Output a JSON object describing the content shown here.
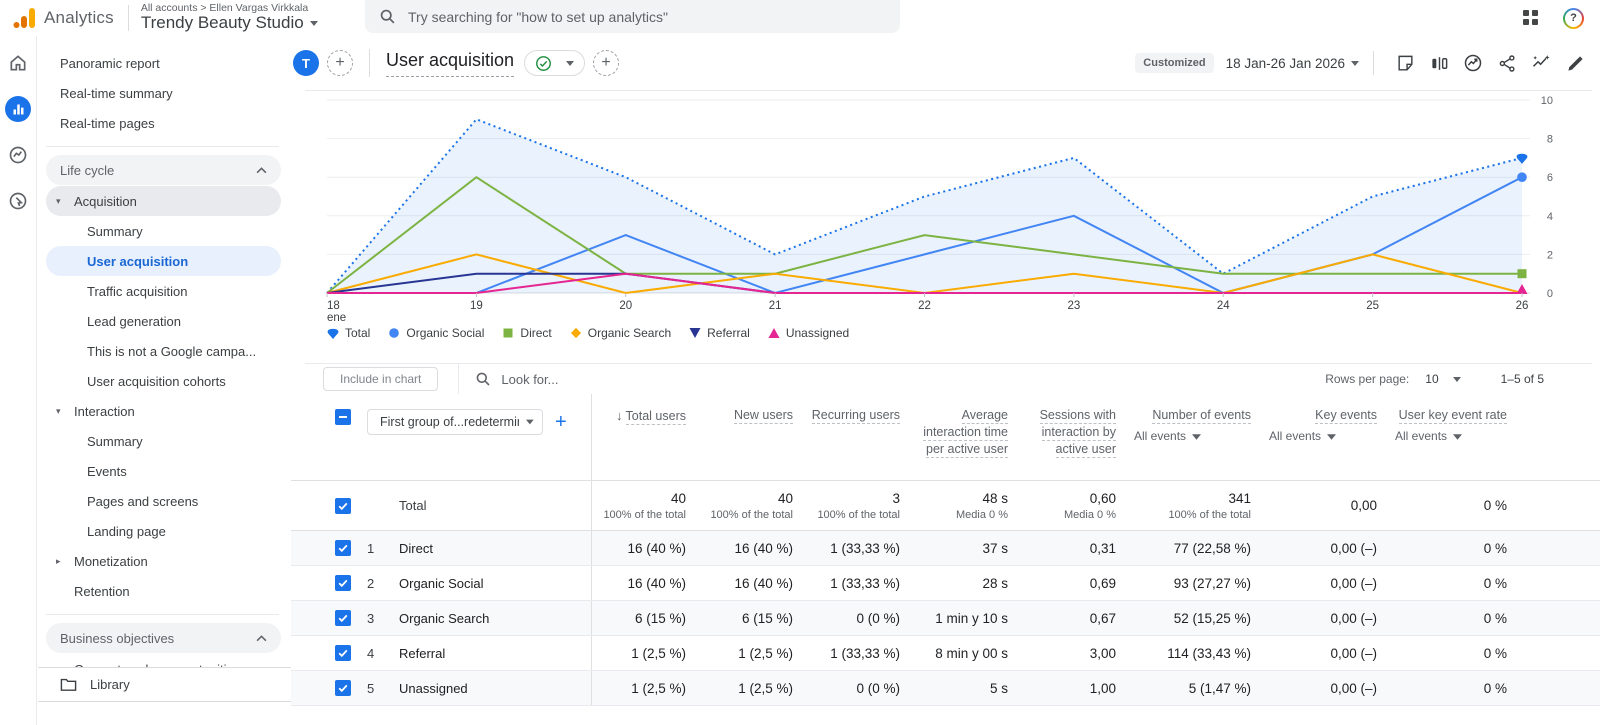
{
  "header": {
    "product": "Analytics",
    "breadcrumb": "All accounts > Ellen Vargas Virkkala",
    "property": "Trendy Beauty Studio",
    "search_placeholder": "Try searching for \"how to set up analytics\""
  },
  "report_header": {
    "avatar": "T",
    "title": "User acquisition",
    "customized_label": "Customized",
    "date_range": "18 Jan-26 Jan 2026"
  },
  "sidebar": {
    "items": [
      {
        "kind": "link",
        "label": "Panoramic report"
      },
      {
        "kind": "link",
        "label": "Real-time summary"
      },
      {
        "kind": "link",
        "label": "Real-time pages"
      },
      {
        "kind": "divider"
      },
      {
        "kind": "section",
        "label": "Life cycle",
        "chevron": "up"
      },
      {
        "kind": "group-open",
        "label": "Acquisition",
        "active": true
      },
      {
        "kind": "sub",
        "label": "Summary"
      },
      {
        "kind": "sub",
        "label": "User acquisition",
        "selected": true
      },
      {
        "kind": "sub",
        "label": "Traffic acquisition"
      },
      {
        "kind": "sub",
        "label": "Lead generation"
      },
      {
        "kind": "sub",
        "label": "This is not a Google campa..."
      },
      {
        "kind": "sub",
        "label": "User acquisition cohorts"
      },
      {
        "kind": "group-open",
        "label": "Interaction"
      },
      {
        "kind": "sub",
        "label": "Summary"
      },
      {
        "kind": "sub",
        "label": "Events"
      },
      {
        "kind": "sub",
        "label": "Pages and screens"
      },
      {
        "kind": "sub",
        "label": "Landing page"
      },
      {
        "kind": "group-closed",
        "label": "Monetization"
      },
      {
        "kind": "mid",
        "label": "Retention"
      },
      {
        "kind": "divider"
      },
      {
        "kind": "section",
        "label": "Business objectives",
        "chevron": "up"
      },
      {
        "kind": "group-closed",
        "label": "Generate sales opportunities"
      }
    ],
    "library_label": "Library"
  },
  "chart_data": {
    "type": "line",
    "x_labels": [
      [
        "18",
        "ene"
      ],
      "19",
      "20",
      "21",
      "22",
      "23",
      "24",
      "25",
      "26"
    ],
    "ylim": [
      0,
      10
    ],
    "yticks": [
      0,
      2,
      4,
      6,
      8,
      10
    ],
    "legend_position": "bottom-left",
    "grid": true,
    "series": [
      {
        "name": "Total",
        "color": "#1a73e8",
        "style": "dotted",
        "fill": true,
        "marker": "pin",
        "end_marker": true,
        "values": [
          0,
          9,
          6,
          2,
          5,
          7,
          1,
          5,
          7
        ]
      },
      {
        "name": "Organic Social",
        "color": "#4285f4",
        "style": "solid",
        "fill": false,
        "marker": "circle",
        "end_marker": true,
        "values": [
          0,
          0,
          3,
          0,
          2,
          4,
          0,
          2,
          6
        ]
      },
      {
        "name": "Direct",
        "color": "#7cb342",
        "style": "solid",
        "fill": false,
        "marker": "square",
        "end_marker": true,
        "values": [
          0,
          6,
          1,
          1,
          3,
          2,
          1,
          1,
          1
        ]
      },
      {
        "name": "Organic Search",
        "color": "#f9ab00",
        "style": "solid",
        "fill": false,
        "marker": "diamond",
        "end_marker": false,
        "values": [
          0,
          2,
          0,
          1,
          0,
          1,
          0,
          2,
          0
        ]
      },
      {
        "name": "Referral",
        "color": "#283593",
        "style": "solid",
        "fill": false,
        "marker": "triangle-down",
        "end_marker": false,
        "values": [
          0,
          1,
          1,
          0,
          0,
          0,
          0,
          0,
          0
        ]
      },
      {
        "name": "Unassigned",
        "color": "#e52592",
        "style": "solid",
        "fill": false,
        "marker": "triangle-up",
        "end_marker": true,
        "values": [
          0,
          0,
          1,
          0,
          0,
          0,
          0,
          0,
          0
        ]
      }
    ]
  },
  "table": {
    "include_in_chart": "Include in chart",
    "search_placeholder": "Look for...",
    "dimension_dropdown": "First group of...redetermined)",
    "pagination": {
      "rows_per_page_label": "Rows per page:",
      "rows_per_page_value": "10",
      "range_label": "1–5 of 5"
    },
    "columns": [
      {
        "label": "Total users",
        "sorted": true
      },
      {
        "label": "New users"
      },
      {
        "label": "Recurring users"
      },
      {
        "label": "Average interaction time per active user"
      },
      {
        "label": "Sessions with interaction by active user"
      },
      {
        "label": "Number of events",
        "filter": "All events"
      },
      {
        "label": "Key events",
        "filter": "All events"
      },
      {
        "label": "User key event rate",
        "filter": "All events"
      }
    ],
    "total_row": {
      "label": "Total",
      "cells": [
        {
          "value": "40",
          "caption": "100% of the total"
        },
        {
          "value": "40",
          "caption": "100% of the total"
        },
        {
          "value": "3",
          "caption": "100% of the total"
        },
        {
          "value": "48 s",
          "caption": "Media 0 %"
        },
        {
          "value": "0,60",
          "caption": "Media 0 %"
        },
        {
          "value": "341",
          "caption": "100% of the total"
        },
        {
          "value": "0,00",
          "caption": ""
        },
        {
          "value": "0 %",
          "caption": ""
        }
      ]
    },
    "rows": [
      {
        "num": "1",
        "name": "Direct",
        "cells": [
          "16 (40 %)",
          "16 (40 %)",
          "1 (33,33 %)",
          "37 s",
          "0,31",
          "77 (22,58 %)",
          "0,00 (–)",
          "0 %"
        ]
      },
      {
        "num": "2",
        "name": "Organic Social",
        "cells": [
          "16 (40 %)",
          "16 (40 %)",
          "1 (33,33 %)",
          "28 s",
          "0,69",
          "93 (27,27 %)",
          "0,00 (–)",
          "0 %"
        ]
      },
      {
        "num": "3",
        "name": "Organic Search",
        "cells": [
          "6 (15 %)",
          "6 (15 %)",
          "0 (0 %)",
          "1 min y 10 s",
          "0,67",
          "52 (15,25 %)",
          "0,00 (–)",
          "0 %"
        ]
      },
      {
        "num": "4",
        "name": "Referral",
        "cells": [
          "1 (2,5 %)",
          "1 (2,5 %)",
          "1 (33,33 %)",
          "8 min y 00 s",
          "3,00",
          "114 (33,43 %)",
          "0,00 (–)",
          "0 %"
        ]
      },
      {
        "num": "5",
        "name": "Unassigned",
        "cells": [
          "1 (2,5 %)",
          "1 (2,5 %)",
          "0 (0 %)",
          "5 s",
          "1,00",
          "5 (1,47 %)",
          "0,00 (–)",
          "0 %"
        ]
      }
    ]
  }
}
